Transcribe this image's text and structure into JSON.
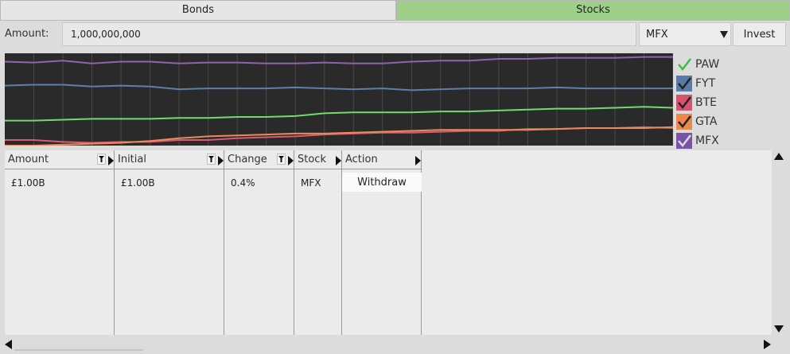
{
  "tabs": [
    {
      "label": "Bonds",
      "active": false
    },
    {
      "label": "Stocks",
      "active": true
    }
  ],
  "toolbar": {
    "amount_label": "Amount:",
    "amount_value": "1,000,000,000",
    "selected_stock": "MFX",
    "invest_label": "Invest"
  },
  "chart_data": {
    "type": "line",
    "xlabel": "",
    "ylabel": "",
    "grid": true,
    "legend_placement": "right",
    "background": "#2a2a2a",
    "x": [
      0,
      1,
      2,
      3,
      4,
      5,
      6,
      7,
      8,
      9,
      10,
      11,
      12,
      13,
      14,
      15,
      16,
      17,
      18,
      19,
      20,
      21,
      22,
      23
    ],
    "ylim": [
      0,
      100
    ],
    "series": [
      {
        "name": "PAW",
        "color": "#8f63b0",
        "values": [
          91,
          90,
          92,
          89,
          91,
          91,
          89,
          90,
          90,
          89,
          89,
          90,
          89,
          89,
          91,
          92,
          92,
          94,
          94,
          95,
          95,
          95,
          96,
          96
        ]
      },
      {
        "name": "FYT",
        "color": "#5d7fa8",
        "values": [
          65,
          66,
          66,
          64,
          65,
          64,
          61,
          62,
          62,
          62,
          63,
          62,
          61,
          62,
          60,
          61,
          62,
          62,
          62,
          63,
          62,
          62,
          62,
          62
        ]
      },
      {
        "name": "BTE",
        "color": "#d85b76",
        "values": [
          6,
          6,
          4,
          3,
          4,
          4,
          6,
          6,
          8,
          9,
          10,
          12,
          13,
          14,
          14,
          15,
          16,
          16,
          18,
          18,
          19,
          19,
          20,
          19
        ]
      },
      {
        "name": "GTA",
        "color": "#ee8a57",
        "values": [
          0,
          0,
          1,
          2,
          3,
          5,
          8,
          10,
          11,
          12,
          13,
          13,
          14,
          15,
          16,
          17,
          17,
          17,
          17,
          18,
          19,
          19,
          19,
          20
        ]
      },
      {
        "name": "MFX",
        "color": "#70dc6c",
        "values": [
          27,
          27,
          28,
          29,
          29,
          29,
          30,
          30,
          31,
          31,
          32,
          35,
          36,
          36,
          36,
          37,
          37,
          38,
          39,
          40,
          40,
          41,
          42,
          41
        ]
      }
    ]
  },
  "legend": {
    "items": [
      {
        "label": "PAW",
        "checked": true,
        "color": "#3bbf3b"
      },
      {
        "label": "FYT",
        "checked": true,
        "color": "#587ca6"
      },
      {
        "label": "BTE",
        "checked": true,
        "color": "#d6526d"
      },
      {
        "label": "GTA",
        "checked": true,
        "color": "#ee874f"
      },
      {
        "label": "MFX",
        "checked": true,
        "color": "#7a52a6"
      }
    ]
  },
  "table": {
    "columns": [
      "Amount",
      "Initial",
      "Change",
      "Stock",
      "Action"
    ],
    "rows": [
      {
        "amount": "£1.00B",
        "initial": "£1.00B",
        "change": "0.4%",
        "stock": "MFX",
        "action": "Withdraw"
      }
    ]
  }
}
